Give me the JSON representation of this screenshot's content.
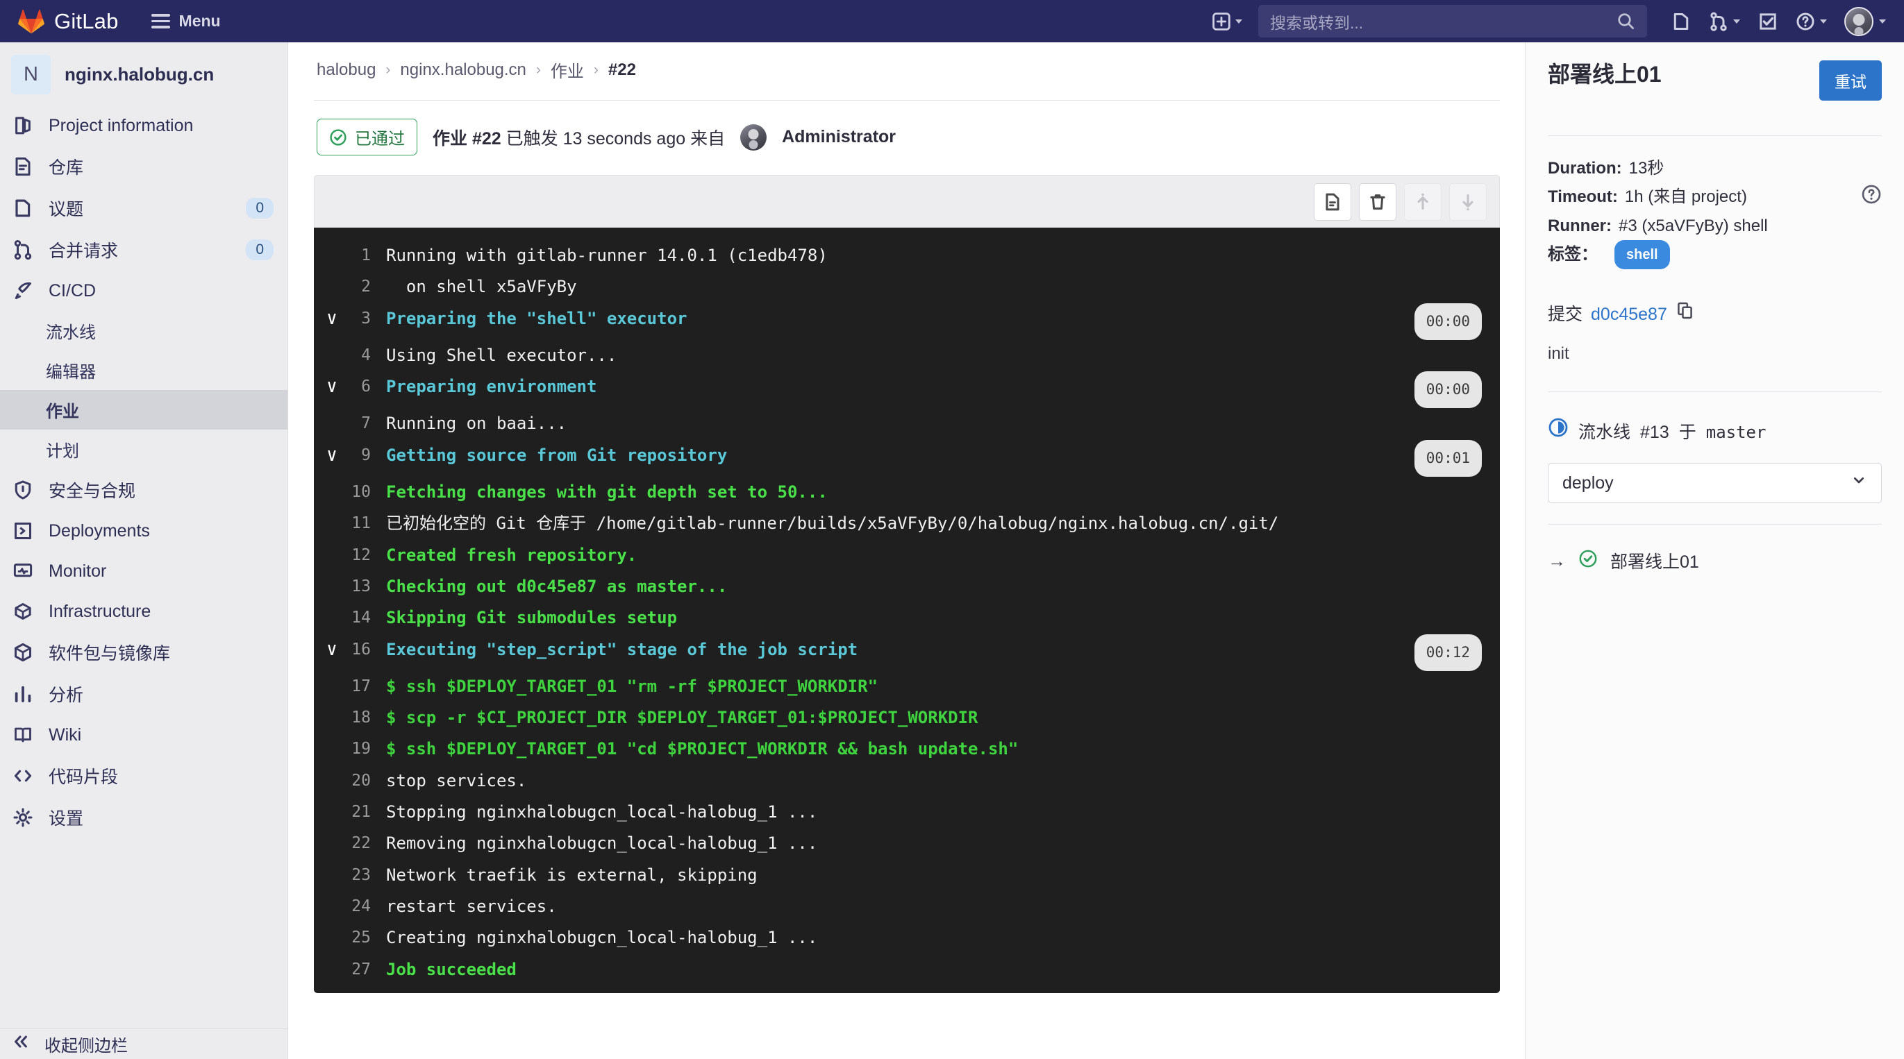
{
  "topnav": {
    "brand": "GitLab",
    "menu_label": "Menu",
    "search_placeholder": "搜索或转到...",
    "icons": {
      "plus": "plus-icon",
      "issues": "issues-icon",
      "merge_requests": "merge-request-icon",
      "todos": "todos-icon",
      "help": "help-icon",
      "search": "search-icon",
      "avatar": "user-avatar"
    }
  },
  "sidebar": {
    "project_initial": "N",
    "project_name": "nginx.halobug.cn",
    "items": [
      {
        "label": "Project information",
        "icon": "project-info-icon",
        "badge": null
      },
      {
        "label": "仓库",
        "icon": "repository-icon",
        "badge": null
      },
      {
        "label": "议题",
        "icon": "issues-icon",
        "badge": "0"
      },
      {
        "label": "合并请求",
        "icon": "merge-request-icon",
        "badge": "0"
      },
      {
        "label": "CI/CD",
        "icon": "rocket-icon",
        "badge": null
      }
    ],
    "cicd_sub": [
      {
        "label": "流水线",
        "active": false
      },
      {
        "label": "编辑器",
        "active": false
      },
      {
        "label": "作业",
        "active": true
      },
      {
        "label": "计划",
        "active": false
      }
    ],
    "items_after": [
      {
        "label": "安全与合规",
        "icon": "shield-icon",
        "badge": null
      },
      {
        "label": "Deployments",
        "icon": "deployments-icon",
        "badge": null
      },
      {
        "label": "Monitor",
        "icon": "monitor-icon",
        "badge": null
      },
      {
        "label": "Infrastructure",
        "icon": "infrastructure-icon",
        "badge": null
      },
      {
        "label": "软件包与镜像库",
        "icon": "package-icon",
        "badge": null
      },
      {
        "label": "分析",
        "icon": "analytics-icon",
        "badge": null
      },
      {
        "label": "Wiki",
        "icon": "wiki-icon",
        "badge": null
      },
      {
        "label": "代码片段",
        "icon": "snippets-icon",
        "badge": null
      },
      {
        "label": "设置",
        "icon": "settings-gear-icon",
        "badge": null
      }
    ],
    "collapse_label": "收起侧边栏"
  },
  "breadcrumb": {
    "group": "halobug",
    "project": "nginx.halobug.cn",
    "section": "作业",
    "current": "#22",
    "separator": "›"
  },
  "job_header": {
    "status_label": "已通过",
    "status_icon": "check-circle-icon",
    "prefix": "作业",
    "job_number": "#22",
    "triggered_text": "已触发",
    "time_ago": "13 seconds ago",
    "by_text": "来自",
    "author": "Administrator"
  },
  "log_toolbar": {
    "buttons": [
      {
        "name": "raw-log-button",
        "icon": "document-icon",
        "disabled": false
      },
      {
        "name": "erase-job-button",
        "icon": "trash-icon",
        "disabled": false
      },
      {
        "name": "scroll-top-button",
        "icon": "arrow-up-icon",
        "disabled": true
      },
      {
        "name": "scroll-bottom-button",
        "icon": "arrow-down-icon",
        "disabled": true
      }
    ]
  },
  "log": {
    "lines": [
      {
        "num": "1",
        "text": "Running with gitlab-runner 14.0.1 (c1edb478)",
        "style": "plain",
        "collapsible": false,
        "duration": null
      },
      {
        "num": "2",
        "text": "  on shell x5aVFyBy",
        "style": "plain",
        "collapsible": false,
        "duration": null
      },
      {
        "num": "3",
        "text": "Preparing the \"shell\" executor",
        "style": "cyan",
        "collapsible": true,
        "duration": "00:00"
      },
      {
        "num": "4",
        "text": "Using Shell executor...",
        "style": "plain",
        "collapsible": false,
        "duration": null
      },
      {
        "num": "6",
        "text": "Preparing environment",
        "style": "cyan",
        "collapsible": true,
        "duration": "00:00"
      },
      {
        "num": "7",
        "text": "Running on baai...",
        "style": "plain",
        "collapsible": false,
        "duration": null
      },
      {
        "num": "9",
        "text": "Getting source from Git repository",
        "style": "cyan",
        "collapsible": true,
        "duration": "00:01"
      },
      {
        "num": "10",
        "text": "Fetching changes with git depth set to 50...",
        "style": "green",
        "collapsible": false,
        "duration": null
      },
      {
        "num": "11",
        "text": "已初始化空的 Git 仓库于 /home/gitlab-runner/builds/x5aVFyBy/0/halobug/nginx.halobug.cn/.git/",
        "style": "plain",
        "collapsible": false,
        "duration": null
      },
      {
        "num": "12",
        "text": "Created fresh repository.",
        "style": "green",
        "collapsible": false,
        "duration": null
      },
      {
        "num": "13",
        "text": "Checking out d0c45e87 as master...",
        "style": "green",
        "collapsible": false,
        "duration": null
      },
      {
        "num": "14",
        "text": "Skipping Git submodules setup",
        "style": "green",
        "collapsible": false,
        "duration": null
      },
      {
        "num": "16",
        "text": "Executing \"step_script\" stage of the job script",
        "style": "cyan",
        "collapsible": true,
        "duration": "00:12"
      },
      {
        "num": "17",
        "text": "$ ssh $DEPLOY_TARGET_01 \"rm -rf $PROJECT_WORKDIR\"",
        "style": "brightgreen",
        "collapsible": false,
        "duration": null
      },
      {
        "num": "18",
        "text": "$ scp -r $CI_PROJECT_DIR $DEPLOY_TARGET_01:$PROJECT_WORKDIR",
        "style": "brightgreen",
        "collapsible": false,
        "duration": null
      },
      {
        "num": "19",
        "text": "$ ssh $DEPLOY_TARGET_01 \"cd $PROJECT_WORKDIR && bash update.sh\"",
        "style": "brightgreen",
        "collapsible": false,
        "duration": null
      },
      {
        "num": "20",
        "text": "stop services.",
        "style": "plain",
        "collapsible": false,
        "duration": null
      },
      {
        "num": "21",
        "text": "Stopping nginxhalobugcn_local-halobug_1 ...",
        "style": "plain",
        "collapsible": false,
        "duration": null
      },
      {
        "num": "22",
        "text": "Removing nginxhalobugcn_local-halobug_1 ...",
        "style": "plain",
        "collapsible": false,
        "duration": null
      },
      {
        "num": "23",
        "text": "Network traefik is external, skipping",
        "style": "plain",
        "collapsible": false,
        "duration": null
      },
      {
        "num": "24",
        "text": "restart services.",
        "style": "plain",
        "collapsible": false,
        "duration": null
      },
      {
        "num": "25",
        "text": "Creating nginxhalobugcn_local-halobug_1 ...",
        "style": "plain",
        "collapsible": false,
        "duration": null
      },
      {
        "num": "27",
        "text": "Job succeeded",
        "style": "green",
        "collapsible": false,
        "duration": null
      }
    ]
  },
  "rightpanel": {
    "job_name": "部署线上01",
    "retry_label": "重试",
    "duration_label": "Duration:",
    "duration_value": "13秒",
    "timeout_label": "Timeout:",
    "timeout_value": "1h (来自 project)",
    "runner_label": "Runner:",
    "runner_value": "#3 (x5aVFyBy) shell",
    "tags_label": "标签：",
    "tags": [
      "shell"
    ],
    "commit_label": "提交",
    "commit_sha": "d0c45e87",
    "copy_icon": "copy-icon",
    "commit_message": "init",
    "pipeline_label": "流水线",
    "pipeline_number": "#13",
    "pipeline_on": "于",
    "pipeline_ref": "master",
    "stage_selected": "deploy",
    "stage_options": [
      "deploy"
    ],
    "job_entry_label": "部署线上01",
    "job_entry_status_icon": "check-circle-icon"
  },
  "colors": {
    "nav_bg": "#292961",
    "accent_blue": "#2b74c9",
    "status_green": "#24753f",
    "log_bg": "#1f1f1f",
    "log_cyan": "#5bc8d8",
    "log_green": "#4ae04a"
  }
}
